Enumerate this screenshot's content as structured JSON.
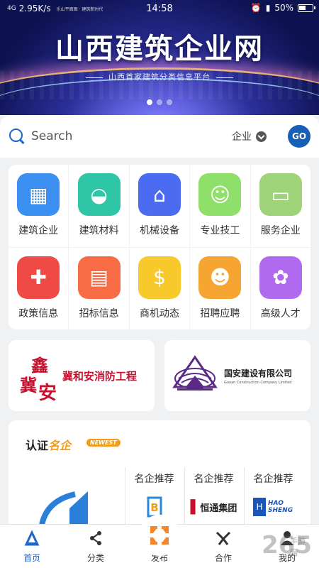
{
  "status_bar": {
    "network": "4G",
    "speed": "2.95K/s",
    "carrier_small": "乐山平面图 · 建筑新时代",
    "time": "14:58",
    "battery": "50%"
  },
  "banner": {
    "title": "山西建筑企业网",
    "subtitle": "山西首家建筑分类信息平台",
    "dots": 3,
    "active_dot": 0
  },
  "search": {
    "placeholder": "Search",
    "scope": "企业",
    "go_label": "GO"
  },
  "categories": [
    {
      "label": "建筑企业",
      "icon": "building-icon",
      "color": "#3b8ff0"
    },
    {
      "label": "建筑材料",
      "icon": "bucket-icon",
      "color": "#2fc6a8"
    },
    {
      "label": "机械设备",
      "icon": "crane-icon",
      "color": "#4b6cf0"
    },
    {
      "label": "专业技工",
      "icon": "worker-icon",
      "color": "#8ee06a"
    },
    {
      "label": "服务企业",
      "icon": "briefcase-icon",
      "color": "#9fd37a"
    },
    {
      "label": "政策信息",
      "icon": "policy-book-icon",
      "color": "#f04a46"
    },
    {
      "label": "招标信息",
      "icon": "box-icon",
      "color": "#f76b45"
    },
    {
      "label": "商机动态",
      "icon": "lightbulb-dollar-icon",
      "color": "#f7c92b"
    },
    {
      "label": "招聘应聘",
      "icon": "badge-icon",
      "color": "#f7a532"
    },
    {
      "label": "高级人才",
      "icon": "medal-icon",
      "color": "#b06af0"
    }
  ],
  "ads": {
    "left": {
      "logo_chars": [
        "鑫",
        "冀",
        "安"
      ],
      "text": "冀和安消防工程"
    },
    "right": {
      "name": "国安建设有限公司",
      "english": "Guoan Construction Company Limited"
    }
  },
  "famous": {
    "title_a": "认证",
    "title_b": "名企",
    "badge": "NEWEST",
    "recommend_label": "名企推荐",
    "rec_logos": [
      {
        "text": "",
        "icon": "b-logo-icon"
      },
      {
        "text": "恒通集团",
        "icon": "hengtong-logo-icon"
      },
      {
        "text": "HAO SHENG",
        "icon": "haosheng-logo-icon"
      }
    ]
  },
  "tabbar": [
    {
      "label": "首页",
      "icon": "home-icon",
      "active": true
    },
    {
      "label": "分类",
      "icon": "category-icon",
      "active": false
    },
    {
      "label": "发布",
      "icon": "publish-icon",
      "active": false
    },
    {
      "label": "合作",
      "icon": "cooperation-icon",
      "active": false
    },
    {
      "label": "我的",
      "icon": "profile-icon",
      "active": false
    }
  ],
  "watermark": {
    "text": "265",
    "sub": "手游网"
  }
}
